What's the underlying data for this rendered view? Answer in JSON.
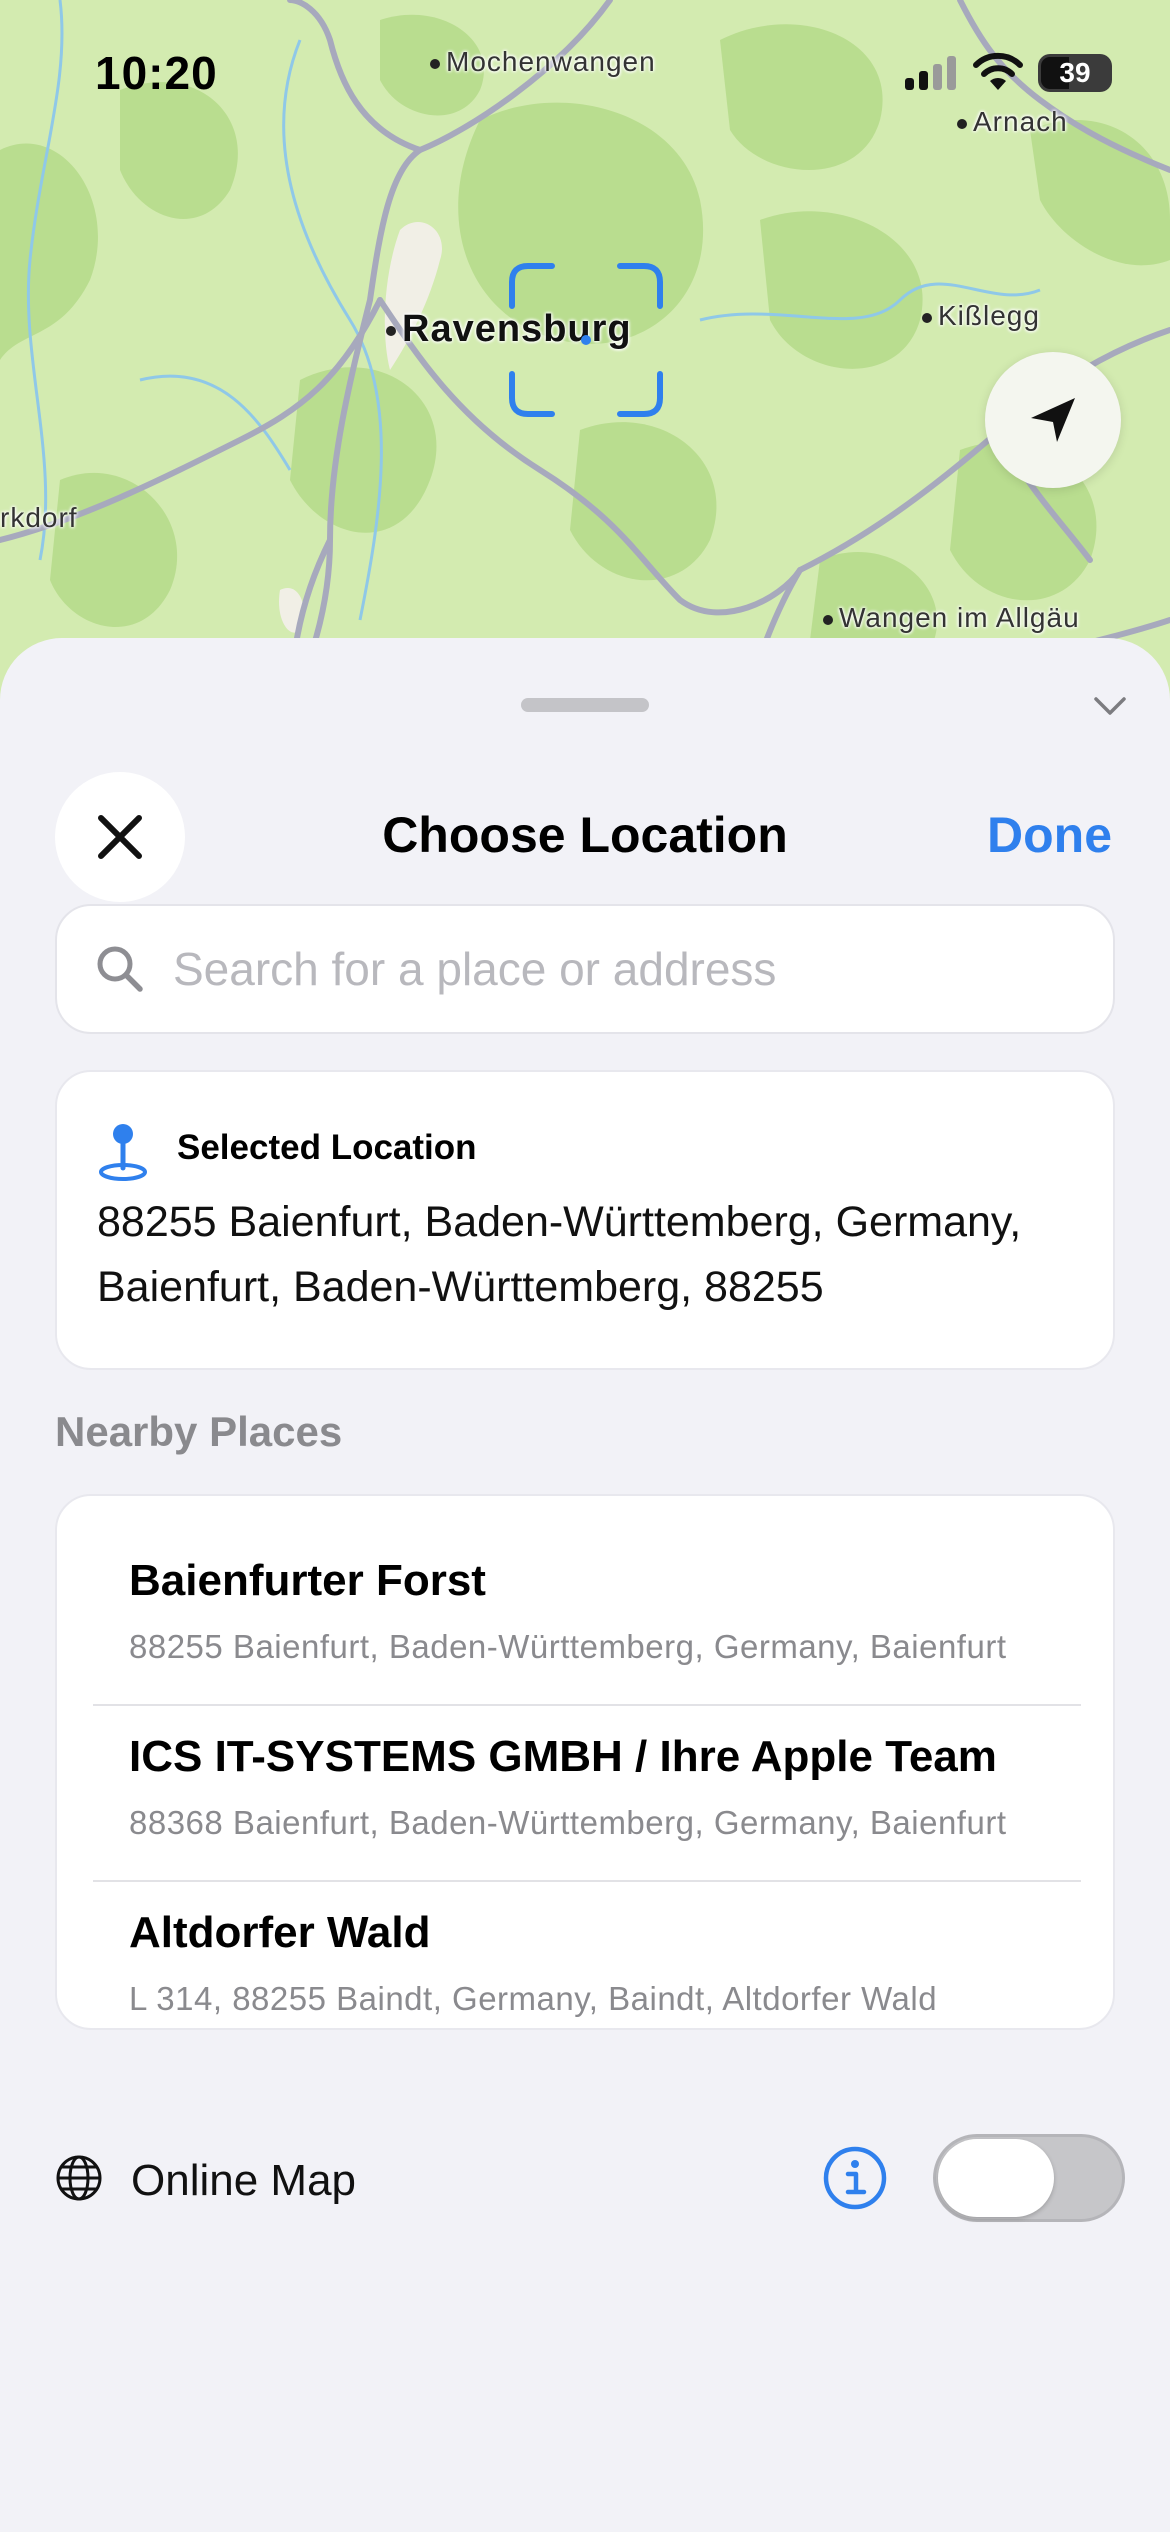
{
  "status_bar": {
    "time": "10:20",
    "battery_level": "39"
  },
  "map": {
    "places": [
      {
        "name": "Mochenwangen"
      },
      {
        "name": "Arnach"
      },
      {
        "name": "Ravensburg"
      },
      {
        "name": "Kißlegg"
      },
      {
        "name": "rkdorf"
      },
      {
        "name": "Wangen im Allgäu"
      }
    ],
    "colors": {
      "land": "#d3ebb0",
      "forest": "#b9dd8f",
      "road": "#a7a9bd",
      "water": "#8fc8e8",
      "accent": "#2f80ed"
    }
  },
  "sheet": {
    "title": "Choose Location",
    "done_label": "Done",
    "search_placeholder": "Search for a place or address",
    "selected_location": {
      "label": "Selected Location",
      "address": "88255 Baienfurt, Baden-Württemberg, Germany, Baienfurt, Baden-Württemberg, 88255"
    },
    "nearby_header": "Nearby Places",
    "nearby_places": [
      {
        "name": "Baienfurter Forst",
        "address": "88255 Baienfurt, Baden-Württemberg, Germany, Baienfurt"
      },
      {
        "name": "ICS IT-SYSTEMS GMBH / Ihre Apple Team",
        "address": "88368 Baienfurt, Baden-Württemberg, Germany, Baienfurt"
      },
      {
        "name": "Altdorfer Wald",
        "address": "L 314, 88255 Baindt, Germany, Baindt, Altdorfer Wald"
      }
    ],
    "online_map": {
      "label": "Online Map",
      "enabled": false
    }
  }
}
